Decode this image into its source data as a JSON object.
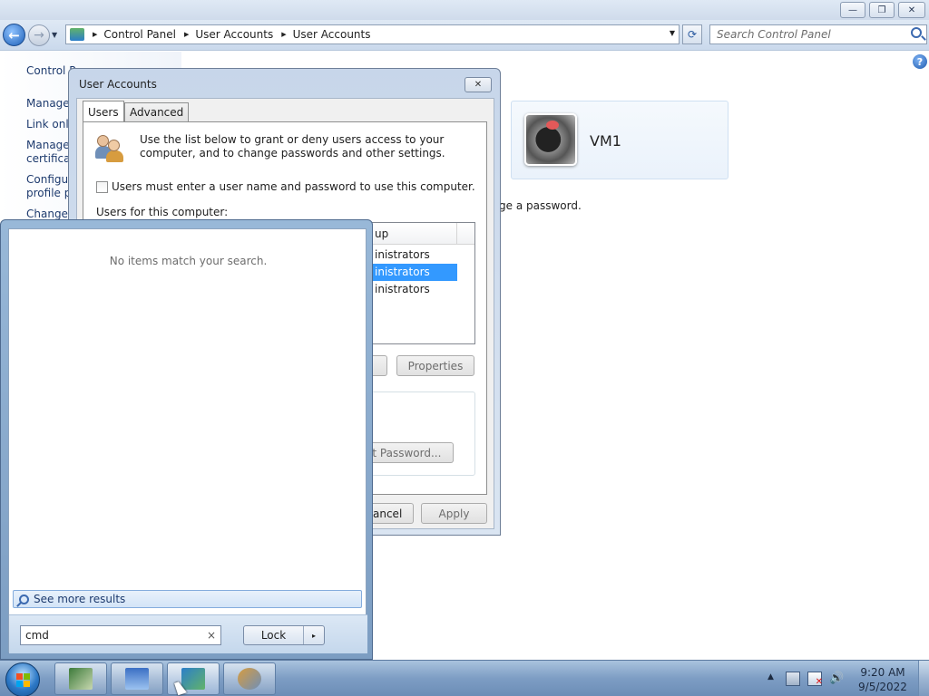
{
  "window": {
    "minimize_label": "—",
    "restore_label": "❐",
    "close_label": "✕"
  },
  "toolbar": {
    "back_label": "←",
    "forward_label": "→",
    "breadcrumbs": [
      "Control Panel",
      "User Accounts",
      "User Accounts"
    ],
    "refresh_label": "⟳",
    "search_placeholder": "Search Control Panel"
  },
  "left_pane": {
    "links": [
      "Control P",
      "Manage",
      "Link onli",
      "Manage",
      "certificat",
      "Configu",
      "profile pr",
      "Change"
    ]
  },
  "account": {
    "name": "VM1",
    "password_text": "ge a password."
  },
  "dialog": {
    "title": "User Accounts",
    "close_label": "✕",
    "tabs": [
      "Users",
      "Advanced"
    ],
    "intro": "Use the list below to grant or deny users access to your computer, and to change passwords and other settings.",
    "checkbox_label": "Users must enter a user name and password to use this computer.",
    "users_label": "Users for this computer:",
    "column_group": "up",
    "rows": [
      {
        "group": "inistrators",
        "selected": false
      },
      {
        "group": "inistrators",
        "selected": true
      },
      {
        "group": "inistrators",
        "selected": false
      }
    ],
    "properties_label": "Properties",
    "reset_password_label": "et Password...",
    "cancel_label": "ancel",
    "apply_label": "Apply"
  },
  "start_menu": {
    "no_items": "No items match your search.",
    "see_more": "See more results",
    "search_value": "cmd",
    "clear_label": "×",
    "lock_label": "Lock",
    "lock_arrow": "▸"
  },
  "taskbar": {
    "time": "9:20 AM",
    "date": "9/5/2022",
    "tray_arrow": "▲"
  },
  "colors": {
    "selection": "#3399ff",
    "taskbar": "#7d9dc4",
    "link": "#1e3b6e"
  }
}
